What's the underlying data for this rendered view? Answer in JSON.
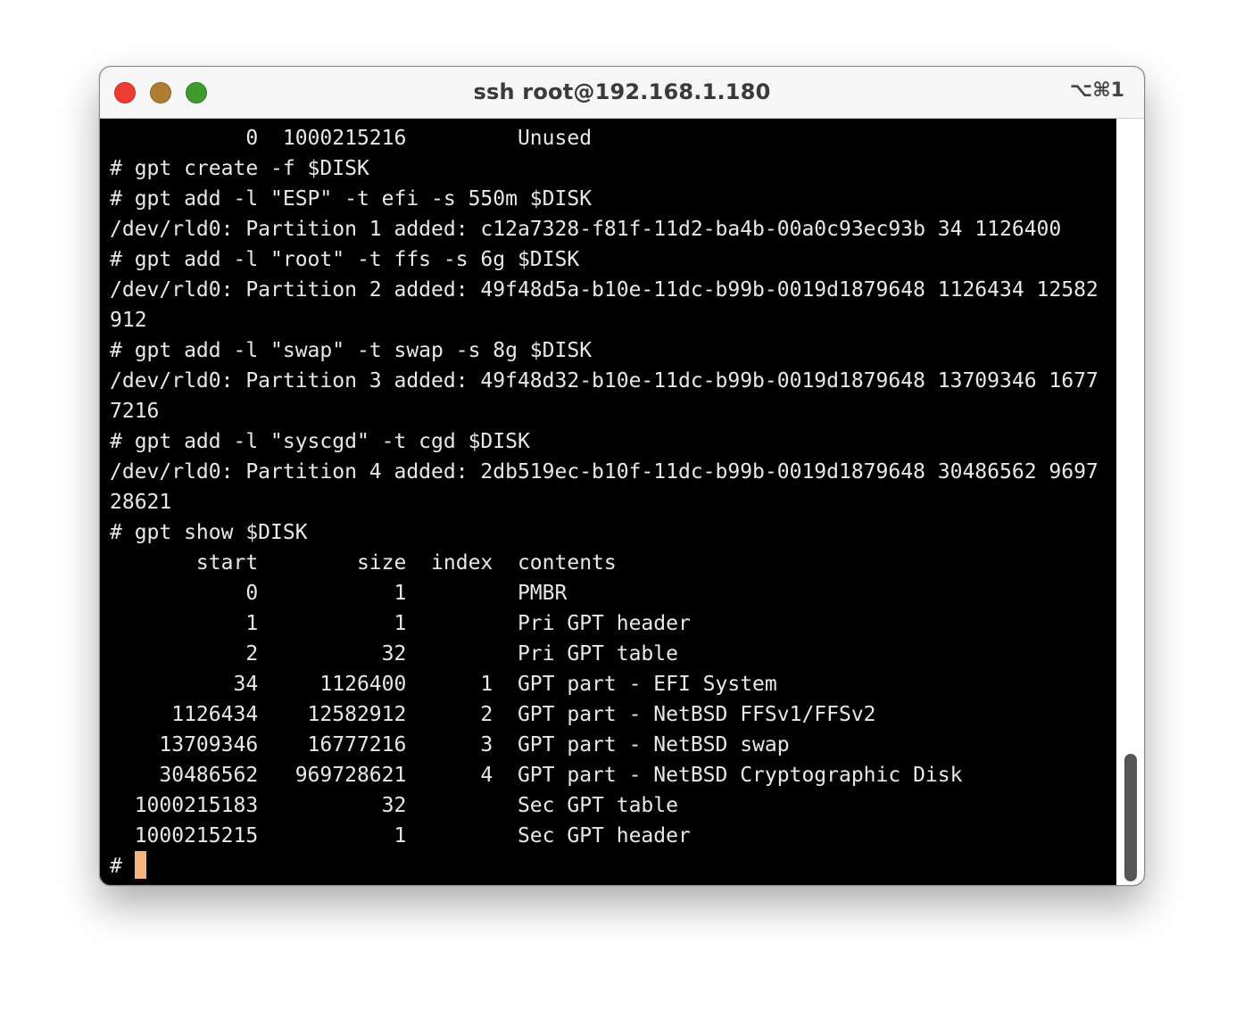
{
  "window": {
    "title": "ssh root@192.168.1.180",
    "shortcut": "⌥⌘1"
  },
  "terminal": {
    "lines": [
      "           0  1000215216         Unused",
      "# gpt create -f $DISK",
      "# gpt add -l \"ESP\" -t efi -s 550m $DISK",
      "/dev/rld0: Partition 1 added: c12a7328-f81f-11d2-ba4b-00a0c93ec93b 34 1126400",
      "# gpt add -l \"root\" -t ffs -s 6g $DISK",
      "/dev/rld0: Partition 2 added: 49f48d5a-b10e-11dc-b99b-0019d1879648 1126434 12582",
      "912",
      "# gpt add -l \"swap\" -t swap -s 8g $DISK",
      "/dev/rld0: Partition 3 added: 49f48d32-b10e-11dc-b99b-0019d1879648 13709346 1677",
      "7216",
      "# gpt add -l \"syscgd\" -t cgd $DISK",
      "/dev/rld0: Partition 4 added: 2db519ec-b10f-11dc-b99b-0019d1879648 30486562 9697",
      "28621",
      "# gpt show $DISK",
      "       start        size  index  contents",
      "           0           1         PMBR",
      "           1           1         Pri GPT header",
      "           2          32         Pri GPT table",
      "          34     1126400      1  GPT part - EFI System",
      "     1126434    12582912      2  GPT part - NetBSD FFSv1/FFSv2",
      "    13709346    16777216      3  GPT part - NetBSD swap",
      "    30486562   969728621      4  GPT part - NetBSD Cryptographic Disk",
      "  1000215183          32         Sec GPT table",
      "  1000215215           1         Sec GPT header"
    ],
    "prompt": "#"
  },
  "colors": {
    "background": "#000000",
    "foreground": "#e8e8e8",
    "cursor": "#f6b47c",
    "close": "#ec3b32",
    "minimize": "#b07d33",
    "zoom": "#3f9a2f"
  }
}
